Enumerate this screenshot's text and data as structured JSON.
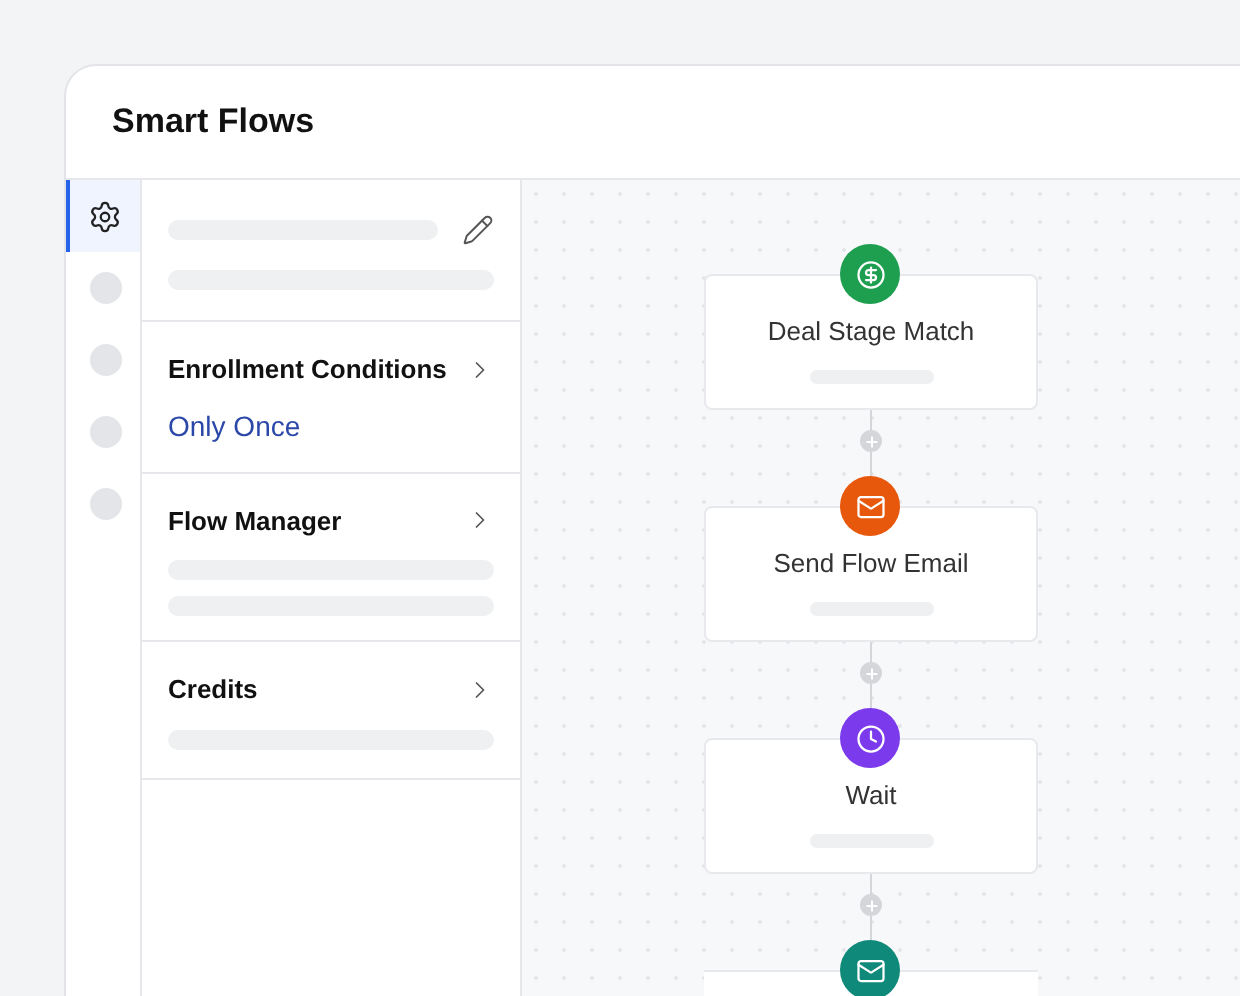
{
  "window": {
    "title": "Smart Flows"
  },
  "rail": [
    {
      "kind": "settings",
      "selected": true
    },
    {
      "kind": "placeholder",
      "selected": false
    },
    {
      "kind": "placeholder",
      "selected": false
    },
    {
      "kind": "placeholder",
      "selected": false
    },
    {
      "kind": "placeholder",
      "selected": false
    }
  ],
  "sections": [
    {
      "kind": "skeleton"
    },
    {
      "kind": "value",
      "title": "Enrollment Conditions",
      "value": "Only Once"
    },
    {
      "kind": "lines",
      "title": "Flow Manager"
    },
    {
      "kind": "line",
      "title": "Credits"
    }
  ],
  "nodes": [
    {
      "kind": "deal",
      "label": "Deal Stage Match",
      "color": "#1e9e4f"
    },
    {
      "kind": "email",
      "label": "Send Flow Email",
      "color": "#e8580c"
    },
    {
      "kind": "wait",
      "label": "Wait",
      "color": "#7c3aed"
    },
    {
      "kind": "email",
      "color": "#0f8a7a"
    }
  ]
}
